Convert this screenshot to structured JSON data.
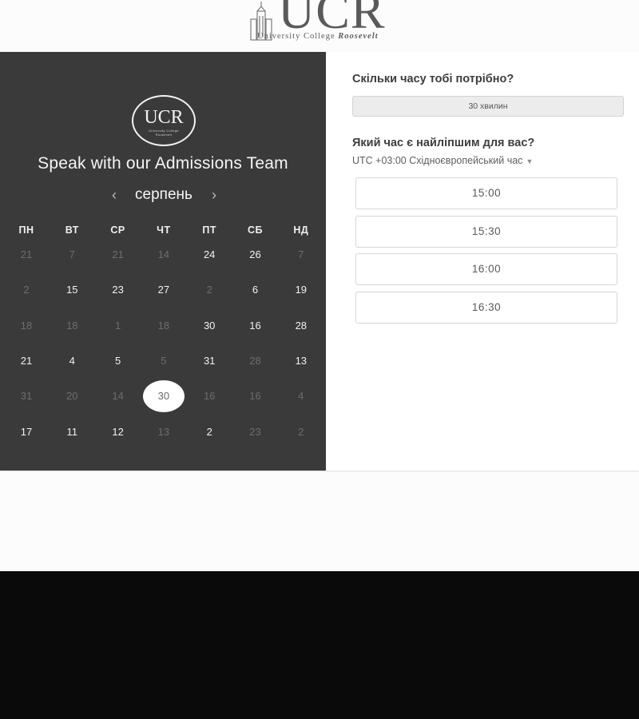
{
  "header": {
    "logo_letters": "UCR",
    "logo_subtitle_prefix": "University College",
    "logo_subtitle_emph": "Roosevelt"
  },
  "left_panel": {
    "badge_letters": "UCR",
    "badge_subtitle": "University College Roosevelt",
    "title": "Speak with our Admissions Team",
    "month": "серпень",
    "prev_icon": "chevron-left-icon",
    "next_icon": "chevron-right-icon",
    "weekdays": [
      "ПН",
      "ВТ",
      "СР",
      "ЧТ",
      "ПТ",
      "СБ",
      "НД"
    ],
    "weeks": [
      [
        {
          "d": "21",
          "m": true
        },
        {
          "d": "7",
          "m": true
        },
        {
          "d": "21",
          "m": true
        },
        {
          "d": "14",
          "m": true
        },
        {
          "d": "24",
          "m": false
        },
        {
          "d": "26",
          "m": false
        },
        {
          "d": "7",
          "m": true
        }
      ],
      [
        {
          "d": "2",
          "m": true
        },
        {
          "d": "15",
          "m": false
        },
        {
          "d": "23",
          "m": false
        },
        {
          "d": "27",
          "m": false
        },
        {
          "d": "2",
          "m": true
        },
        {
          "d": "6",
          "m": false
        },
        {
          "d": "19",
          "m": false
        }
      ],
      [
        {
          "d": "18",
          "m": true
        },
        {
          "d": "18",
          "m": true
        },
        {
          "d": "1",
          "m": true
        },
        {
          "d": "18",
          "m": true
        },
        {
          "d": "30",
          "m": false
        },
        {
          "d": "16",
          "m": false
        },
        {
          "d": "28",
          "m": false
        }
      ],
      [
        {
          "d": "21",
          "m": false
        },
        {
          "d": "4",
          "m": false
        },
        {
          "d": "5",
          "m": false
        },
        {
          "d": "5",
          "m": true
        },
        {
          "d": "31",
          "m": false
        },
        {
          "d": "28",
          "m": true
        },
        {
          "d": "13",
          "m": false
        }
      ],
      [
        {
          "d": "31",
          "m": true
        },
        {
          "d": "20",
          "m": true
        },
        {
          "d": "14",
          "m": true
        },
        {
          "d": "30",
          "m": false,
          "s": true
        },
        {
          "d": "16",
          "m": true
        },
        {
          "d": "16",
          "m": true
        },
        {
          "d": "4",
          "m": true
        }
      ],
      [
        {
          "d": "17",
          "m": false
        },
        {
          "d": "11",
          "m": false
        },
        {
          "d": "12",
          "m": false
        },
        {
          "d": "13",
          "m": true
        },
        {
          "d": "2",
          "m": false
        },
        {
          "d": "23",
          "m": true
        },
        {
          "d": "2",
          "m": true
        }
      ]
    ]
  },
  "right_panel": {
    "duration_question": "Скільки часу тобі потрібно?",
    "duration_value": "30 хвилин",
    "time_question": "Який час є найліпшим для вас?",
    "timezone": "UTC +03:00 Східноєвропейський час",
    "slots": [
      "15:00",
      "15:30",
      "16:00",
      "16:30"
    ]
  },
  "colors": {
    "panel_dark": "#3a3a3a",
    "page_bg": "#fcfcfc",
    "footer": "#0a0a0a"
  }
}
